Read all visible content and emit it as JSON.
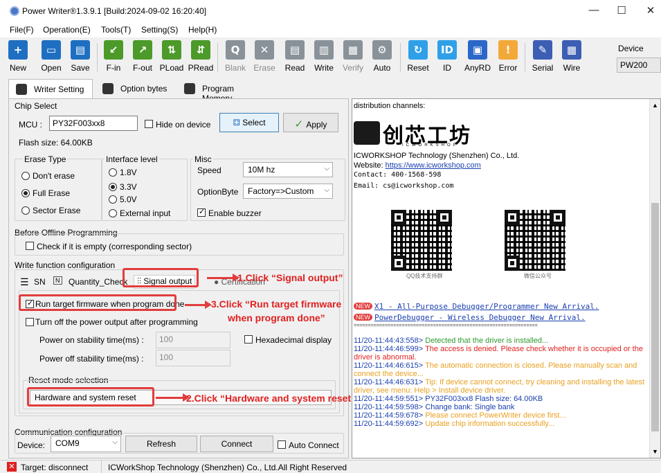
{
  "window": {
    "title": "Power Writer®1.3.9.1 [Build:2024-09-02 16:20:40]"
  },
  "menu": [
    "File(F)",
    "Operation(E)",
    "Tools(T)",
    "Setting(S)",
    "Help(H)"
  ],
  "toolbar": {
    "buttons": [
      {
        "label": "New",
        "icon": "new-icon"
      },
      {
        "label": "Open",
        "icon": "open-icon"
      },
      {
        "label": "Save",
        "icon": "save-icon"
      },
      {
        "label": "F-in",
        "icon": "file-in-icon"
      },
      {
        "label": "F-out",
        "icon": "file-out-icon"
      },
      {
        "label": "PLoad",
        "icon": "program-load-icon"
      },
      {
        "label": "PRead",
        "icon": "program-read-icon"
      },
      {
        "label": "Blank",
        "icon": "blank-check-icon"
      },
      {
        "label": "Erase",
        "icon": "erase-icon"
      },
      {
        "label": "Read",
        "icon": "read-icon"
      },
      {
        "label": "Write",
        "icon": "write-icon"
      },
      {
        "label": "Verify",
        "icon": "verify-icon"
      },
      {
        "label": "Auto",
        "icon": "auto-icon"
      },
      {
        "label": "Reset",
        "icon": "reset-icon"
      },
      {
        "label": "ID",
        "icon": "id-icon"
      },
      {
        "label": "AnyRD",
        "icon": "any-read-icon"
      },
      {
        "label": "Error",
        "icon": "error-icon"
      },
      {
        "label": "Serial",
        "icon": "serial-icon"
      },
      {
        "label": "Wire",
        "icon": "wire-icon"
      }
    ],
    "device_label": "Device",
    "device_value": "PW200"
  },
  "tabs": [
    "Writer Setting",
    "Option bytes",
    "Program Memory"
  ],
  "chip_select": {
    "legend": "Chip Select",
    "mcu_label": "MCU :",
    "mcu_value": "PY32F003xx8",
    "hide_label": "Hide on device",
    "select_btn": "Select",
    "apply_btn": "Apply",
    "flash": "Flash size: 64.00KB"
  },
  "erase_type": {
    "legend": "Erase Type",
    "options": [
      "Don't erase",
      "Full Erase",
      "Sector Erase"
    ]
  },
  "interface": {
    "legend": "Interface level",
    "options": [
      "1.8V",
      "3.3V",
      "5.0V",
      "External input"
    ]
  },
  "misc": {
    "legend": "Misc",
    "speed_label": "Speed",
    "speed_value": "10M hz",
    "ob_label": "OptionByte",
    "ob_value": "Factory=>Custom",
    "buzzer_label": "Enable buzzer"
  },
  "before_offline": {
    "legend": "Before Offline Programming",
    "check_label": "Check if it is empty (corresponding sector)"
  },
  "write_func": {
    "legend": "Write function configuration",
    "subtabs": [
      "SN",
      "Quantity_Check",
      "Signal output",
      "Certification"
    ],
    "run_label": "Run target firmware when program done",
    "turnoff_label": "Turn off the power output after programming",
    "power_on_label": "Power on stability time(ms) :",
    "power_on_value": "100",
    "power_off_label": "Power off stability time(ms) :",
    "power_off_value": "100",
    "hex_label": "Hexadecimal display",
    "reset_legend": "Reset mode selection",
    "reset_value": "Hardware and  system reset"
  },
  "annotations": {
    "a1": "1.Click “Signal output”",
    "a2": "2.Click “Hardware and system reset”",
    "a3_line1": "3.Click “Run target firmware",
    "a3_line2": "when program done”"
  },
  "comm": {
    "legend": "Communication configuration",
    "device_label": "Device:",
    "device_value": "COM9",
    "refresh_btn": "Refresh",
    "connect_btn": "Connect",
    "auto_label": "Auto Connect"
  },
  "right": {
    "top_text": "distribution channels:",
    "brand_cn": "创芯工坊",
    "brand_en": "ICWORKSHOP",
    "company": "ICWORKSHOP Technology (Shenzhen) Co., Ltd.",
    "website_label": "Website:",
    "website": "https://www.icworkshop.com",
    "contact": "Contact: 400-1568-598",
    "email": "Email: cs@icworkshop.com",
    "qr1_caption": "QQ技术支持群",
    "qr2_caption": "微信公众号",
    "new_badge": "NEW",
    "news1": "X1 - All-Purpose Debugger/Programmer New Arrival.",
    "news2": "PowerDebugger - Wireless Debugger New Arrival.",
    "divider": "=================================================================",
    "log": [
      {
        "ts": "11/20-11:44:43:558>",
        "msg": "Detected that the driver is installed...",
        "color": "#2e9a2e"
      },
      {
        "ts": "11/20-11:44:46:599>",
        "msg": "The access is denied. Please check whether it is occupied or the driver is abnormal.",
        "color": "#e02020"
      },
      {
        "ts": "11/20-11:44:46:615>",
        "msg": "The automatic connection is closed. Please manually scan and connect the device...",
        "color": "#e8a020"
      },
      {
        "ts": "11/20-11:44:46:631>",
        "msg": "Tip: If device cannot connect, try cleaning and installing the latest driver, see menu: Help > Install device driver.",
        "color": "#e8a020"
      },
      {
        "ts": "11/20-11:44:59:551>",
        "msg": "PY32F003xx8 Flash size: 64.00KB",
        "color": "#1a3fb0"
      },
      {
        "ts": "11/20-11:44:59:598>",
        "msg": "Change bank: Single bank",
        "color": "#1a3fb0"
      },
      {
        "ts": "11/20-11:44:59:678>",
        "msg": "Please connect PowerWriter device first...",
        "color": "#e8a020"
      },
      {
        "ts": "11/20-11:44:59:692>",
        "msg": "Update chip information successfully...",
        "color": "#e8a020"
      }
    ]
  },
  "status": {
    "target": "Target: disconnect",
    "copyright": "ICWorkShop Technology  (Shenzhen)  Co.,  Ltd.All Right Reserved"
  },
  "colors": {
    "accent": "#e23c3c",
    "log_ts": "#1a3fb0"
  }
}
